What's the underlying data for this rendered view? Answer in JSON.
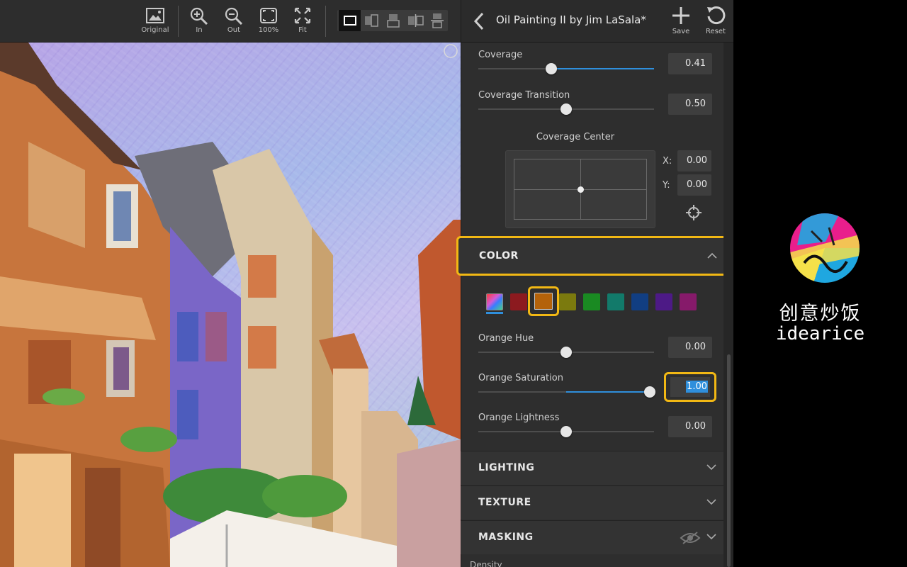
{
  "toolbar": {
    "buttons": [
      {
        "label": "Original",
        "icon": "image-icon"
      },
      {
        "label": "In",
        "icon": "zoom-in-icon"
      },
      {
        "label": "Out",
        "icon": "zoom-out-icon"
      },
      {
        "label": "100%",
        "icon": "actual-size-icon"
      },
      {
        "label": "Fit",
        "icon": "fit-icon"
      }
    ],
    "view_modes": [
      "single-view-icon",
      "split-vertical-icon",
      "split-horizontal-icon",
      "side-by-side-icon",
      "top-bottom-icon"
    ],
    "active_view_mode": "single-view-icon"
  },
  "panel": {
    "title": "Oil Painting II by Jim LaSala*",
    "save_label": "Save",
    "reset_label": "Reset",
    "coverage": {
      "label": "Coverage",
      "value": "0.41",
      "level": 0.41
    },
    "coverage_transition": {
      "label": "Coverage Transition",
      "value": "0.50",
      "level": 0.5
    },
    "coverage_center": {
      "label": "Coverage Center",
      "x_label": "X:",
      "x_value": "0.00",
      "y_label": "Y:",
      "y_value": "0.00"
    },
    "color_section": {
      "title": "COLOR",
      "swatches": [
        {
          "name": "all-colors",
          "color": "#c06cc9"
        },
        {
          "name": "red",
          "color": "#8c1a1f"
        },
        {
          "name": "orange",
          "color": "#b4620a"
        },
        {
          "name": "yellow",
          "color": "#7b7a0e"
        },
        {
          "name": "green",
          "color": "#1a8a22"
        },
        {
          "name": "aqua",
          "color": "#127a6a"
        },
        {
          "name": "blue",
          "color": "#113e82"
        },
        {
          "name": "purple",
          "color": "#4d1a86"
        },
        {
          "name": "magenta",
          "color": "#861a6a"
        }
      ],
      "selected_swatch": "orange",
      "hue": {
        "label": "Orange Hue",
        "value": "0.00",
        "level": 0.5
      },
      "saturation": {
        "label": "Orange Saturation",
        "value": "1.00",
        "level": 1.0
      },
      "lightness": {
        "label": "Orange Lightness",
        "value": "0.00",
        "level": 0.5
      }
    },
    "sections": [
      {
        "title": "LIGHTING"
      },
      {
        "title": "TEXTURE"
      },
      {
        "title": "MASKING"
      }
    ],
    "next_section_partial": "Density"
  },
  "brand": {
    "name_cn": "创意炒饭",
    "name_en": "idearice"
  },
  "accent_color": "#2f8fdc",
  "highlight_color": "#f2b814"
}
